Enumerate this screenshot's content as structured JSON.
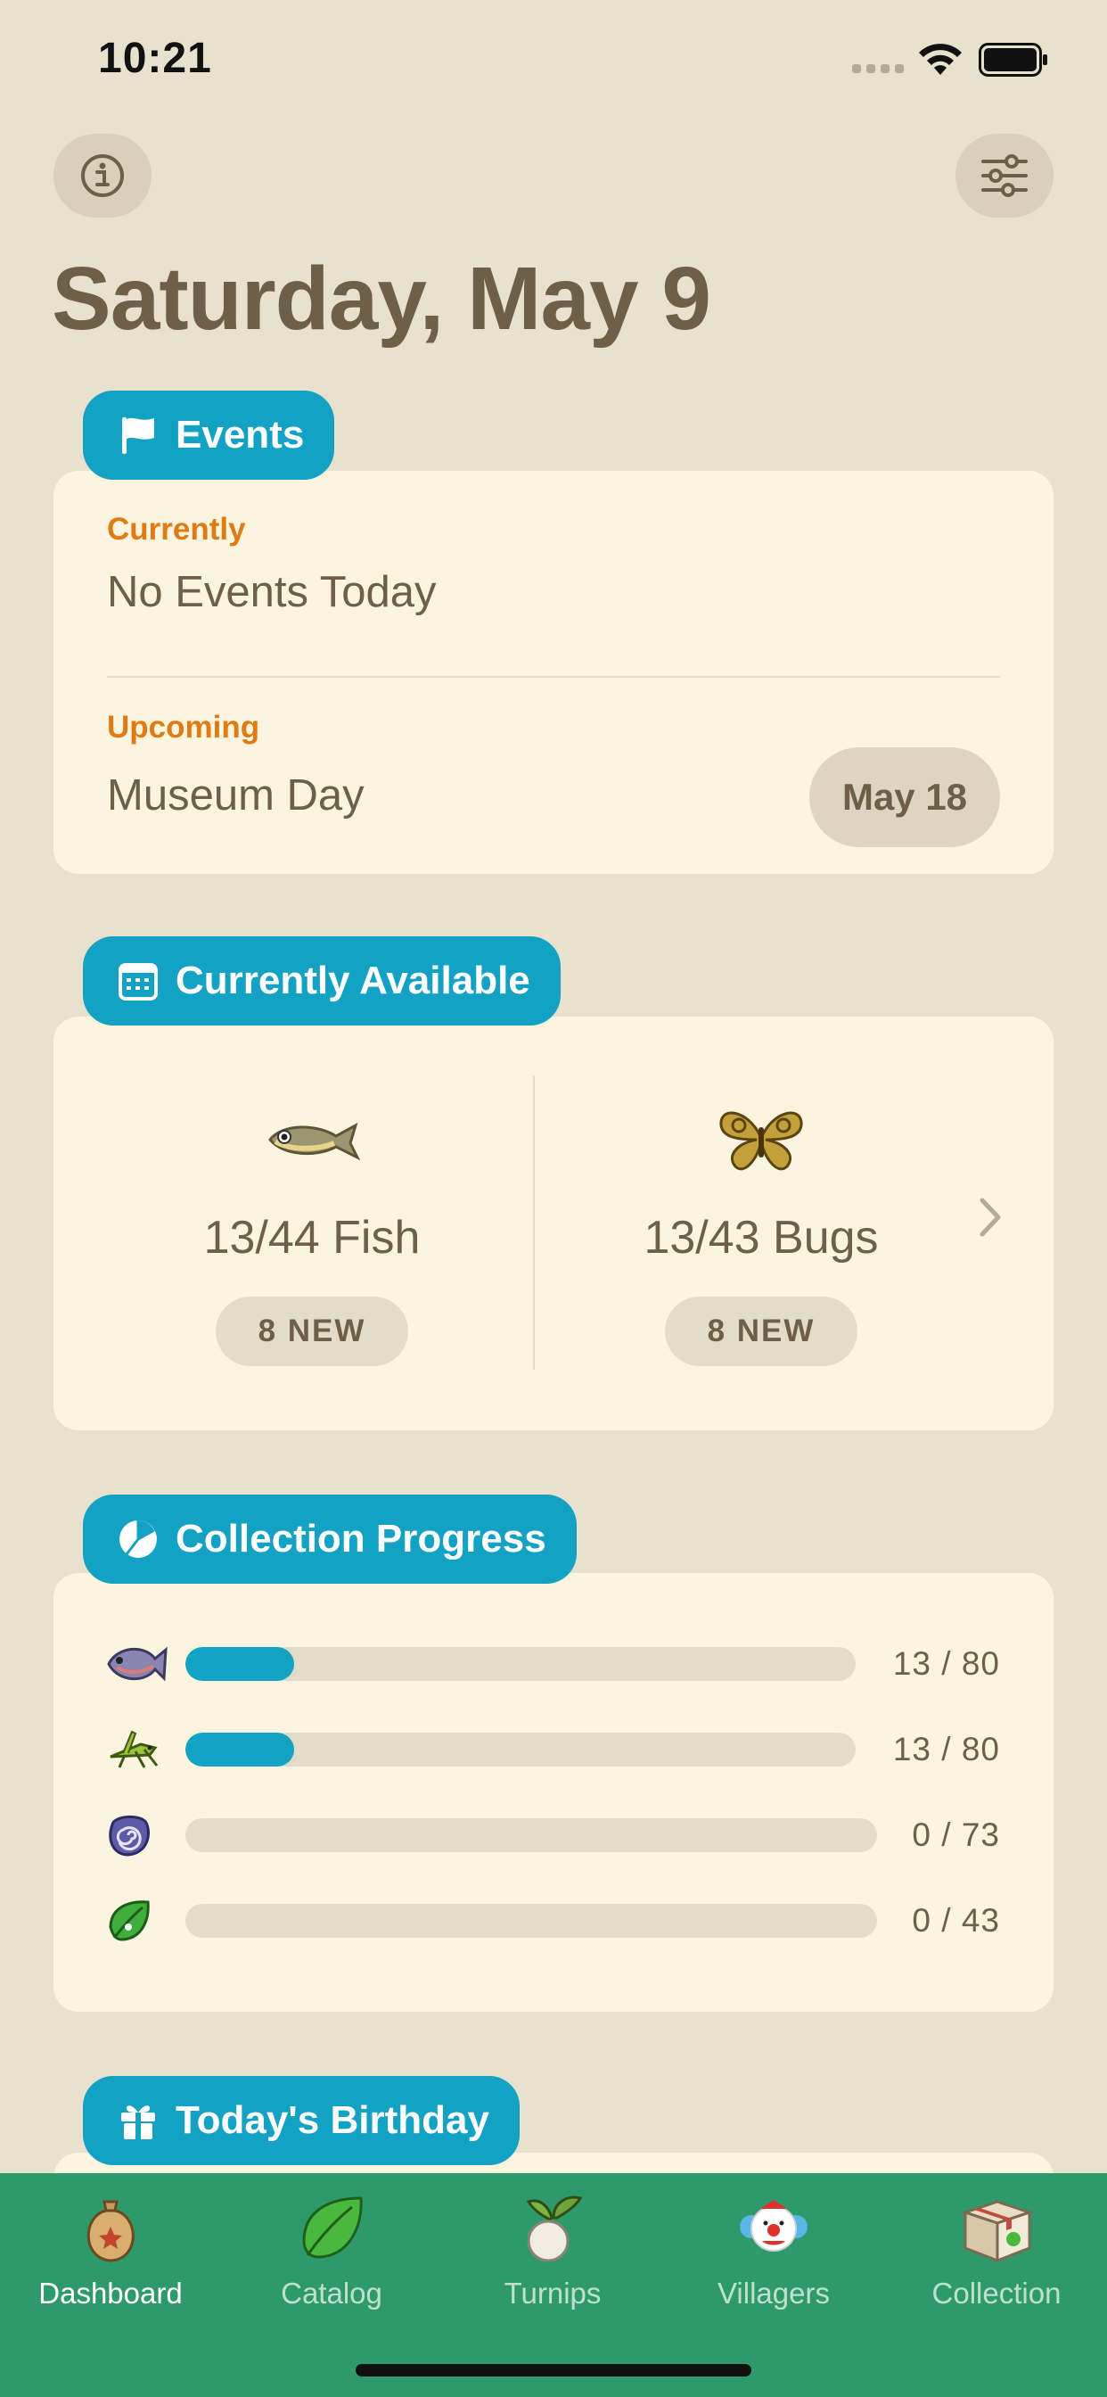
{
  "status_bar": {
    "time": "10:21",
    "icons": [
      "signal-icon",
      "wifi-icon",
      "battery-icon"
    ]
  },
  "header": {
    "info_icon": "info-icon",
    "filter_icon": "sliders-icon",
    "title": "Saturday, May 9"
  },
  "events": {
    "tab_label": "Events",
    "tab_icon": "flag-icon",
    "current_label": "Currently",
    "current_value": "No Events Today",
    "upcoming_label": "Upcoming",
    "upcoming_value": "Museum Day",
    "upcoming_date": "May 18"
  },
  "available": {
    "tab_label": "Currently Available",
    "tab_icon": "calendar-icon",
    "fish": {
      "count": "13/44 Fish",
      "new": "8 NEW",
      "icon": "fish-icon"
    },
    "bugs": {
      "count": "13/43 Bugs",
      "new": "8 NEW",
      "icon": "butterfly-icon"
    }
  },
  "progress": {
    "tab_label": "Collection Progress",
    "tab_icon": "pie-chart-icon",
    "rows": [
      {
        "icon": "fish-icon",
        "label": "13 / 80",
        "value": 13,
        "total": 80
      },
      {
        "icon": "grasshopper-icon",
        "label": "13 / 80",
        "value": 13,
        "total": 80
      },
      {
        "icon": "fossil-icon",
        "label": "0 / 73",
        "value": 0,
        "total": 73
      },
      {
        "icon": "leaf-icon",
        "label": "0 / 43",
        "value": 0,
        "total": 43
      }
    ]
  },
  "birthday": {
    "tab_label": "Today's Birthday",
    "tab_icon": "gift-icon"
  },
  "tab_bar": {
    "items": [
      {
        "label": "Dashboard",
        "icon": "bell-bag-icon",
        "active": true
      },
      {
        "label": "Catalog",
        "icon": "leaf-icon",
        "active": false
      },
      {
        "label": "Turnips",
        "icon": "turnip-icon",
        "active": false
      },
      {
        "label": "Villagers",
        "icon": "villager-icon",
        "active": false
      },
      {
        "label": "Collection",
        "icon": "box-icon",
        "active": false
      }
    ]
  },
  "colors": {
    "background": "#e7e1cd",
    "card": "#fbf5e0",
    "accent": "#14a2c4",
    "orange_label": "#e07a12",
    "text": "#6e5f48",
    "tab_bar": "#2e9a6c"
  }
}
